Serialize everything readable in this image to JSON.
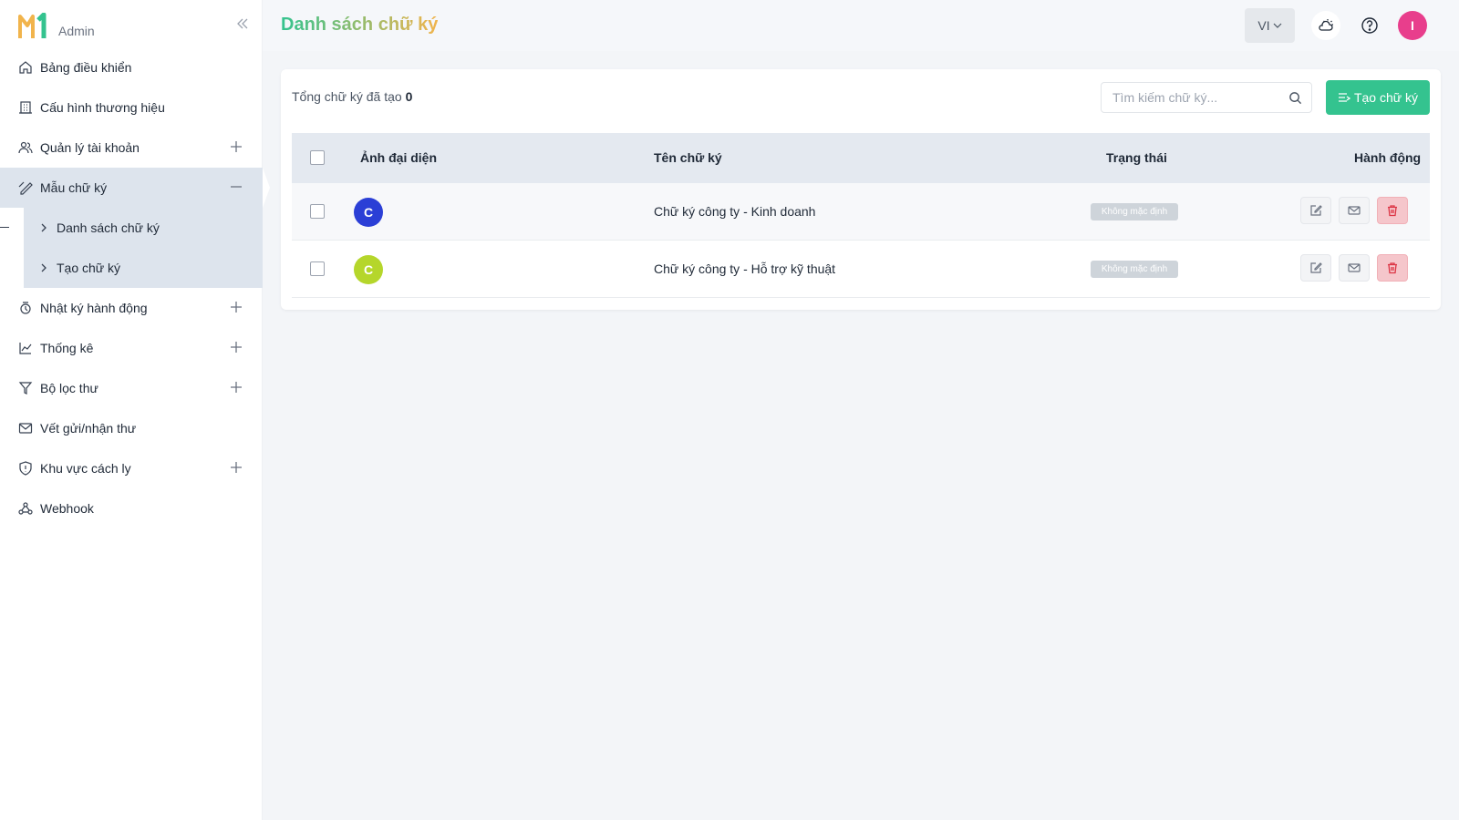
{
  "brand": {
    "logo_text": "M1",
    "label": "Admin",
    "logo_color_left": "#f1b44c",
    "logo_color_right": "#34c38f"
  },
  "sidebar": {
    "items": [
      {
        "label": "Bảng điều khiển",
        "icon": "home-icon"
      },
      {
        "label": "Cấu hình thương hiệu",
        "icon": "building-icon"
      },
      {
        "label": "Quản lý tài khoản",
        "icon": "users-icon",
        "expandable": true
      },
      {
        "label": "Mẫu chữ ký",
        "icon": "signature-icon",
        "expanded": true,
        "active": true
      },
      {
        "label": "Nhật ký hành động",
        "icon": "log-icon",
        "expandable": true
      },
      {
        "label": "Thống kê",
        "icon": "chart-icon",
        "expandable": true
      },
      {
        "label": "Bộ lọc thư",
        "icon": "filter-icon",
        "expandable": true
      },
      {
        "label": "Vết gửi/nhận thư",
        "icon": "mail-icon"
      },
      {
        "label": "Khu vực cách ly",
        "icon": "shield-icon",
        "expandable": true
      },
      {
        "label": "Webhook",
        "icon": "webhook-icon"
      }
    ],
    "sub_items": [
      {
        "label": "Danh sách chữ ký",
        "active": true
      },
      {
        "label": "Tạo chữ ký"
      }
    ]
  },
  "header": {
    "title": "Danh sách chữ ký",
    "language": "VI",
    "avatar_initial": "I",
    "avatar_color": "#e83e8c"
  },
  "toolbar": {
    "total_label": "Tổng chữ ký đã tạo",
    "total_value": "0",
    "search_placeholder": "Tìm kiếm chữ ký...",
    "create_label": "Tạo chữ ký",
    "accent": "#34c38f"
  },
  "table": {
    "columns": [
      "Ảnh đại diện",
      "Tên chữ ký",
      "Trạng thái",
      "Hành động"
    ],
    "rows": [
      {
        "avatar": "C",
        "avatar_color": "#2b3fd6",
        "name": "Chữ ký công ty - Kinh doanh",
        "status": "Không mặc định"
      },
      {
        "avatar": "C",
        "avatar_color": "#b5d62b",
        "name": "Chữ ký công ty - Hỗ trợ kỹ thuật",
        "status": "Không mặc định"
      }
    ]
  }
}
